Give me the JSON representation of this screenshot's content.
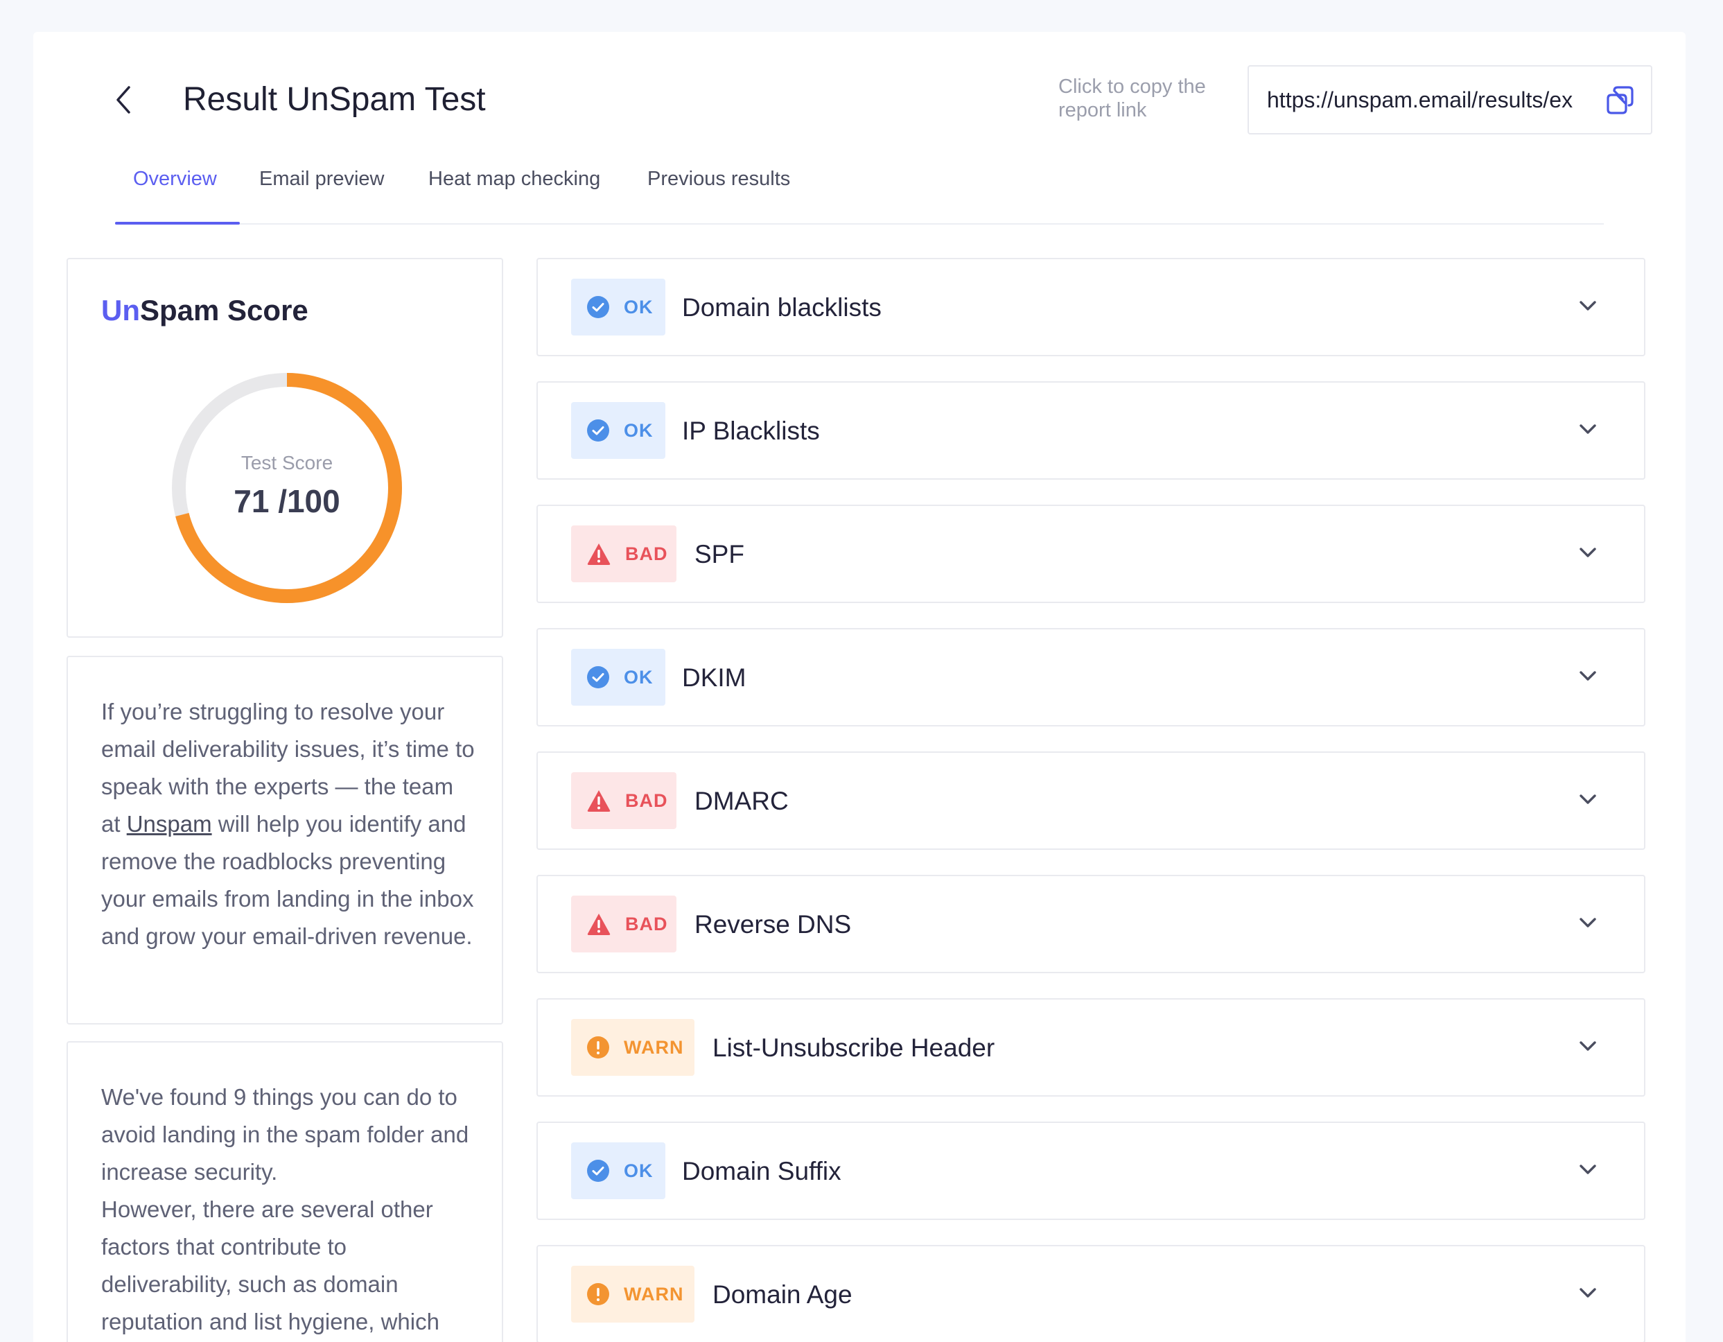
{
  "header": {
    "title": "Result UnSpam Test",
    "copy_hint": "Click to copy the report link",
    "report_link": "https://unspam.email/results/ex"
  },
  "tabs": [
    {
      "label": "Overview",
      "active": true
    },
    {
      "label": "Email preview",
      "active": false
    },
    {
      "label": "Heat map checking",
      "active": false
    },
    {
      "label": "Previous results",
      "active": false
    }
  ],
  "score": {
    "title_accent": "Un",
    "title_rest": "Spam Score",
    "label": "Test Score",
    "value": 71,
    "max": 100,
    "display": "71 /100",
    "color": "#f7922a",
    "track_color": "#e8e8ea"
  },
  "info": {
    "paragraph1_before": "If you’re struggling to resolve your email deliverability issues, it’s time to speak with the experts — the team at ",
    "paragraph1_link": "Unspam",
    "paragraph1_after": " will help you identify and remove the roadblocks preventing your emails from landing in the inbox and grow your email-driven revenue.",
    "paragraph2_line1": "We've found 9 things you can do to avoid landing in the spam folder and increase security.",
    "paragraph2_line2": "However, there are several other factors that contribute to deliverability, such as domain reputation and list hygiene, which"
  },
  "checks": [
    {
      "status": "ok",
      "badge": "OK",
      "label": "Domain blacklists",
      "icon": "check-circle-icon"
    },
    {
      "status": "ok",
      "badge": "OK",
      "label": "IP Blacklists",
      "icon": "check-circle-icon"
    },
    {
      "status": "bad",
      "badge": "BAD",
      "label": "SPF",
      "icon": "warning-triangle-icon"
    },
    {
      "status": "ok",
      "badge": "OK",
      "label": "DKIM",
      "icon": "check-circle-icon"
    },
    {
      "status": "bad",
      "badge": "BAD",
      "label": "DMARC",
      "icon": "warning-triangle-icon"
    },
    {
      "status": "bad",
      "badge": "BAD",
      "label": "Reverse DNS",
      "icon": "warning-triangle-icon"
    },
    {
      "status": "warn",
      "badge": "WARN",
      "label": "List-Unsubscribe Header",
      "icon": "exclamation-circle-icon"
    },
    {
      "status": "ok",
      "badge": "OK",
      "label": "Domain Suffix",
      "icon": "check-circle-icon"
    },
    {
      "status": "warn",
      "badge": "WARN",
      "label": "Domain Age",
      "icon": "exclamation-circle-icon"
    }
  ],
  "colors": {
    "accent": "#5b5ef0",
    "ok": "#4c8fe8",
    "bad": "#e8525a",
    "warn": "#f39431"
  }
}
